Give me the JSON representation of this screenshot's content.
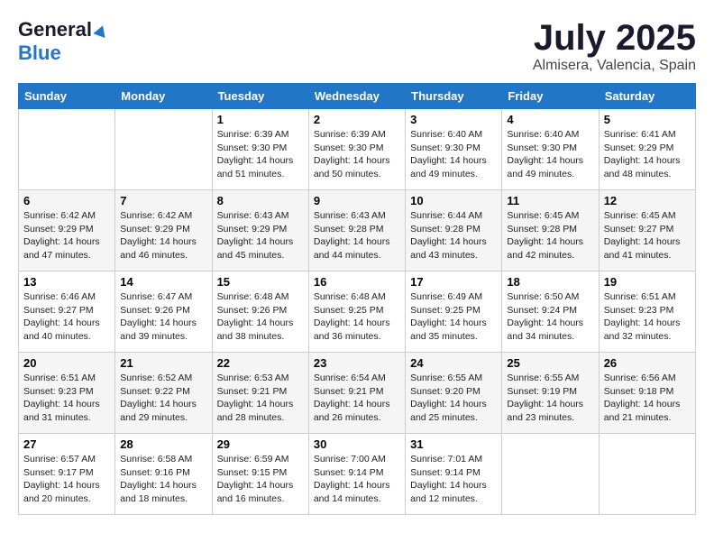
{
  "header": {
    "logo_general": "General",
    "logo_blue": "Blue",
    "month": "July 2025",
    "location": "Almisera, Valencia, Spain"
  },
  "days_of_week": [
    "Sunday",
    "Monday",
    "Tuesday",
    "Wednesday",
    "Thursday",
    "Friday",
    "Saturday"
  ],
  "weeks": [
    [
      {
        "day": "",
        "sunrise": "",
        "sunset": "",
        "daylight": ""
      },
      {
        "day": "",
        "sunrise": "",
        "sunset": "",
        "daylight": ""
      },
      {
        "day": "1",
        "sunrise": "Sunrise: 6:39 AM",
        "sunset": "Sunset: 9:30 PM",
        "daylight": "Daylight: 14 hours and 51 minutes."
      },
      {
        "day": "2",
        "sunrise": "Sunrise: 6:39 AM",
        "sunset": "Sunset: 9:30 PM",
        "daylight": "Daylight: 14 hours and 50 minutes."
      },
      {
        "day": "3",
        "sunrise": "Sunrise: 6:40 AM",
        "sunset": "Sunset: 9:30 PM",
        "daylight": "Daylight: 14 hours and 49 minutes."
      },
      {
        "day": "4",
        "sunrise": "Sunrise: 6:40 AM",
        "sunset": "Sunset: 9:30 PM",
        "daylight": "Daylight: 14 hours and 49 minutes."
      },
      {
        "day": "5",
        "sunrise": "Sunrise: 6:41 AM",
        "sunset": "Sunset: 9:29 PM",
        "daylight": "Daylight: 14 hours and 48 minutes."
      }
    ],
    [
      {
        "day": "6",
        "sunrise": "Sunrise: 6:42 AM",
        "sunset": "Sunset: 9:29 PM",
        "daylight": "Daylight: 14 hours and 47 minutes."
      },
      {
        "day": "7",
        "sunrise": "Sunrise: 6:42 AM",
        "sunset": "Sunset: 9:29 PM",
        "daylight": "Daylight: 14 hours and 46 minutes."
      },
      {
        "day": "8",
        "sunrise": "Sunrise: 6:43 AM",
        "sunset": "Sunset: 9:29 PM",
        "daylight": "Daylight: 14 hours and 45 minutes."
      },
      {
        "day": "9",
        "sunrise": "Sunrise: 6:43 AM",
        "sunset": "Sunset: 9:28 PM",
        "daylight": "Daylight: 14 hours and 44 minutes."
      },
      {
        "day": "10",
        "sunrise": "Sunrise: 6:44 AM",
        "sunset": "Sunset: 9:28 PM",
        "daylight": "Daylight: 14 hours and 43 minutes."
      },
      {
        "day": "11",
        "sunrise": "Sunrise: 6:45 AM",
        "sunset": "Sunset: 9:28 PM",
        "daylight": "Daylight: 14 hours and 42 minutes."
      },
      {
        "day": "12",
        "sunrise": "Sunrise: 6:45 AM",
        "sunset": "Sunset: 9:27 PM",
        "daylight": "Daylight: 14 hours and 41 minutes."
      }
    ],
    [
      {
        "day": "13",
        "sunrise": "Sunrise: 6:46 AM",
        "sunset": "Sunset: 9:27 PM",
        "daylight": "Daylight: 14 hours and 40 minutes."
      },
      {
        "day": "14",
        "sunrise": "Sunrise: 6:47 AM",
        "sunset": "Sunset: 9:26 PM",
        "daylight": "Daylight: 14 hours and 39 minutes."
      },
      {
        "day": "15",
        "sunrise": "Sunrise: 6:48 AM",
        "sunset": "Sunset: 9:26 PM",
        "daylight": "Daylight: 14 hours and 38 minutes."
      },
      {
        "day": "16",
        "sunrise": "Sunrise: 6:48 AM",
        "sunset": "Sunset: 9:25 PM",
        "daylight": "Daylight: 14 hours and 36 minutes."
      },
      {
        "day": "17",
        "sunrise": "Sunrise: 6:49 AM",
        "sunset": "Sunset: 9:25 PM",
        "daylight": "Daylight: 14 hours and 35 minutes."
      },
      {
        "day": "18",
        "sunrise": "Sunrise: 6:50 AM",
        "sunset": "Sunset: 9:24 PM",
        "daylight": "Daylight: 14 hours and 34 minutes."
      },
      {
        "day": "19",
        "sunrise": "Sunrise: 6:51 AM",
        "sunset": "Sunset: 9:23 PM",
        "daylight": "Daylight: 14 hours and 32 minutes."
      }
    ],
    [
      {
        "day": "20",
        "sunrise": "Sunrise: 6:51 AM",
        "sunset": "Sunset: 9:23 PM",
        "daylight": "Daylight: 14 hours and 31 minutes."
      },
      {
        "day": "21",
        "sunrise": "Sunrise: 6:52 AM",
        "sunset": "Sunset: 9:22 PM",
        "daylight": "Daylight: 14 hours and 29 minutes."
      },
      {
        "day": "22",
        "sunrise": "Sunrise: 6:53 AM",
        "sunset": "Sunset: 9:21 PM",
        "daylight": "Daylight: 14 hours and 28 minutes."
      },
      {
        "day": "23",
        "sunrise": "Sunrise: 6:54 AM",
        "sunset": "Sunset: 9:21 PM",
        "daylight": "Daylight: 14 hours and 26 minutes."
      },
      {
        "day": "24",
        "sunrise": "Sunrise: 6:55 AM",
        "sunset": "Sunset: 9:20 PM",
        "daylight": "Daylight: 14 hours and 25 minutes."
      },
      {
        "day": "25",
        "sunrise": "Sunrise: 6:55 AM",
        "sunset": "Sunset: 9:19 PM",
        "daylight": "Daylight: 14 hours and 23 minutes."
      },
      {
        "day": "26",
        "sunrise": "Sunrise: 6:56 AM",
        "sunset": "Sunset: 9:18 PM",
        "daylight": "Daylight: 14 hours and 21 minutes."
      }
    ],
    [
      {
        "day": "27",
        "sunrise": "Sunrise: 6:57 AM",
        "sunset": "Sunset: 9:17 PM",
        "daylight": "Daylight: 14 hours and 20 minutes."
      },
      {
        "day": "28",
        "sunrise": "Sunrise: 6:58 AM",
        "sunset": "Sunset: 9:16 PM",
        "daylight": "Daylight: 14 hours and 18 minutes."
      },
      {
        "day": "29",
        "sunrise": "Sunrise: 6:59 AM",
        "sunset": "Sunset: 9:15 PM",
        "daylight": "Daylight: 14 hours and 16 minutes."
      },
      {
        "day": "30",
        "sunrise": "Sunrise: 7:00 AM",
        "sunset": "Sunset: 9:14 PM",
        "daylight": "Daylight: 14 hours and 14 minutes."
      },
      {
        "day": "31",
        "sunrise": "Sunrise: 7:01 AM",
        "sunset": "Sunset: 9:14 PM",
        "daylight": "Daylight: 14 hours and 12 minutes."
      },
      {
        "day": "",
        "sunrise": "",
        "sunset": "",
        "daylight": ""
      },
      {
        "day": "",
        "sunrise": "",
        "sunset": "",
        "daylight": ""
      }
    ]
  ]
}
